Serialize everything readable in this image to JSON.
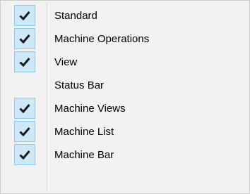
{
  "menu": {
    "items": [
      {
        "label": "Standard",
        "checked": true
      },
      {
        "label": "Machine Operations",
        "checked": true
      },
      {
        "label": "View",
        "checked": true
      },
      {
        "label": "Status Bar",
        "checked": false
      },
      {
        "label": "Machine Views",
        "checked": true
      },
      {
        "label": "Machine List",
        "checked": true
      },
      {
        "label": "Machine Bar",
        "checked": true
      }
    ]
  },
  "colors": {
    "menu_background": "#f2f2f2",
    "check_background": "#cde8f6",
    "check_border": "#8ec8e8",
    "check_mark": "#1a1a1a"
  }
}
